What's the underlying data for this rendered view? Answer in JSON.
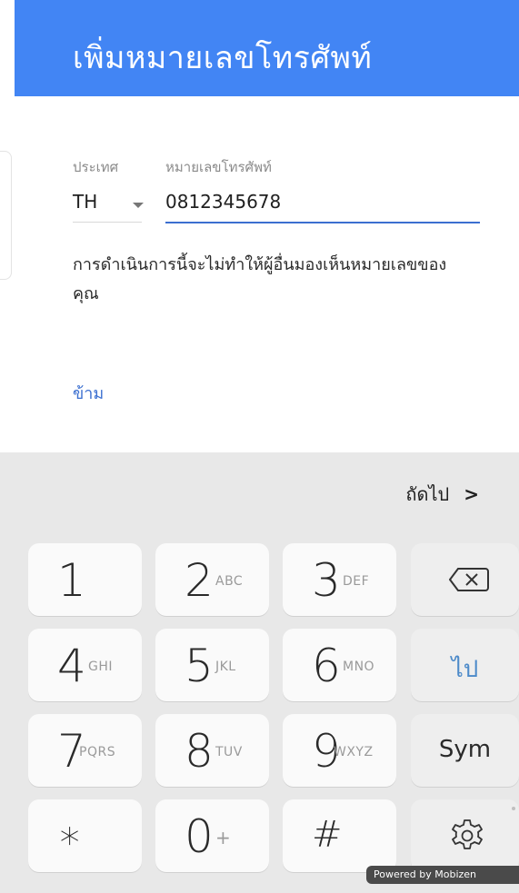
{
  "header": {
    "title": "เพิ่มหมายเลขโทรศัพท์"
  },
  "form": {
    "country_label": "ประเทศ",
    "country_value": "TH",
    "phone_label": "หมายเลขโทรศัพท์",
    "phone_value": "0812345678",
    "description": "การดำเนินการนี้จะไม่ทำให้ผู้อื่นมองเห็นหมายเลขของคุณ",
    "skip_label": "ข้าม"
  },
  "keyboard": {
    "next_label": "ถัดไป",
    "next_chevron": ">",
    "keys": [
      {
        "num": "1",
        "letters": ""
      },
      {
        "num": "2",
        "letters": "ABC"
      },
      {
        "num": "3",
        "letters": "DEF"
      },
      {
        "num": "4",
        "letters": "GHI"
      },
      {
        "num": "5",
        "letters": "JKL"
      },
      {
        "num": "6",
        "letters": "MNO"
      },
      {
        "num": "7",
        "letters": "PQRS"
      },
      {
        "num": "8",
        "letters": "TUV"
      },
      {
        "num": "9",
        "letters": "WXYZ"
      },
      {
        "num": "∗",
        "letters": ""
      },
      {
        "num": "0",
        "letters": "+"
      },
      {
        "num": "#",
        "letters": ""
      }
    ],
    "go_label": "ไป",
    "sym_label": "Sym",
    "backspace_icon": "backspace-icon",
    "settings_icon": "gear-icon"
  },
  "watermark": {
    "text": "Powered by Mobizen"
  },
  "colors": {
    "header": "#4285f4",
    "accent": "#3b6fd0",
    "keyboard_bg": "#e8e8e8"
  }
}
